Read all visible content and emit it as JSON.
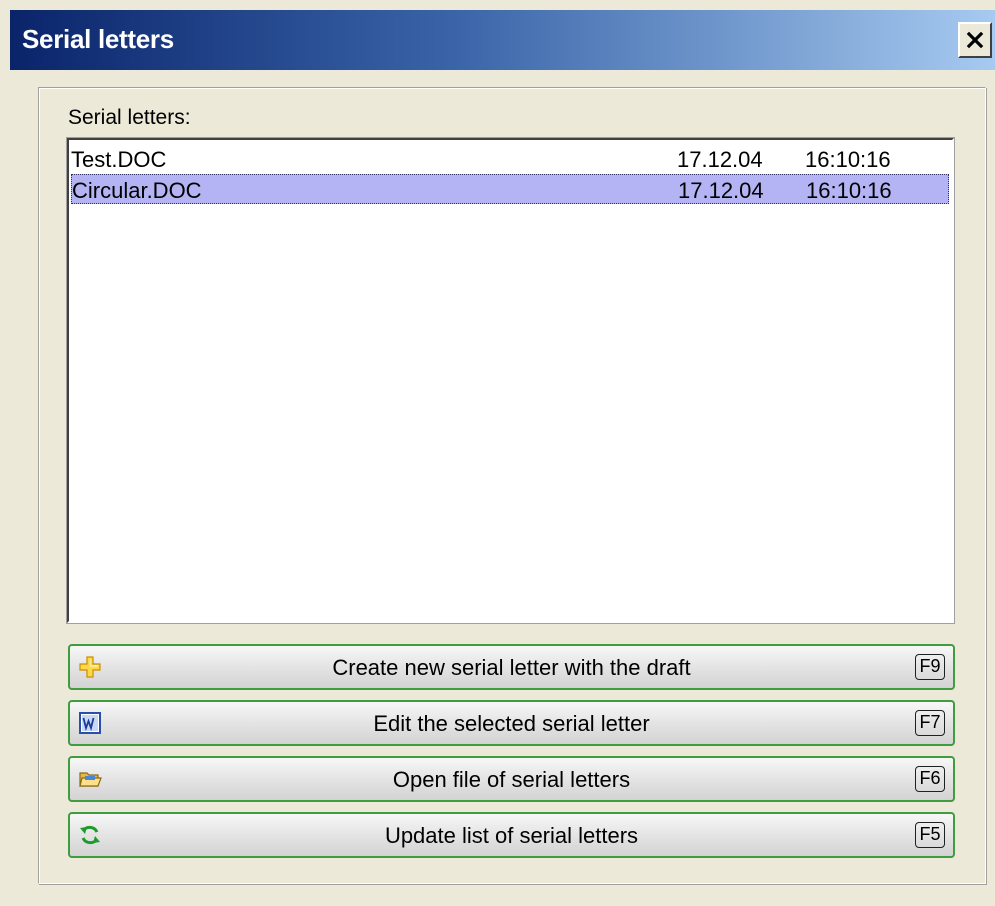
{
  "window": {
    "title": "Serial letters",
    "close_symbol": "✕"
  },
  "list": {
    "label": "Serial letters:",
    "rows": [
      {
        "name": "Test.DOC",
        "date": "17.12.04",
        "time": "16:10:16",
        "selected": false
      },
      {
        "name": "Circular.DOC",
        "date": "17.12.04",
        "time": "16:10:16",
        "selected": true
      }
    ]
  },
  "buttons": [
    {
      "label": "Create new serial letter with the draft",
      "key": "F9",
      "icon": "plus-icon"
    },
    {
      "label": "Edit the selected serial letter",
      "key": "F7",
      "icon": "word-document-icon"
    },
    {
      "label": "Open file of serial letters",
      "key": "F6",
      "icon": "folder-open-icon"
    },
    {
      "label": "Update list of serial letters",
      "key": "F5",
      "icon": "refresh-icon"
    }
  ],
  "colors": {
    "title_gradient_start": "#0a246a",
    "title_gradient_end": "#a6caf0",
    "selection": "#b4b4f4",
    "button_border": "#3f9c3f",
    "dialog_bg": "#ece9d8"
  }
}
